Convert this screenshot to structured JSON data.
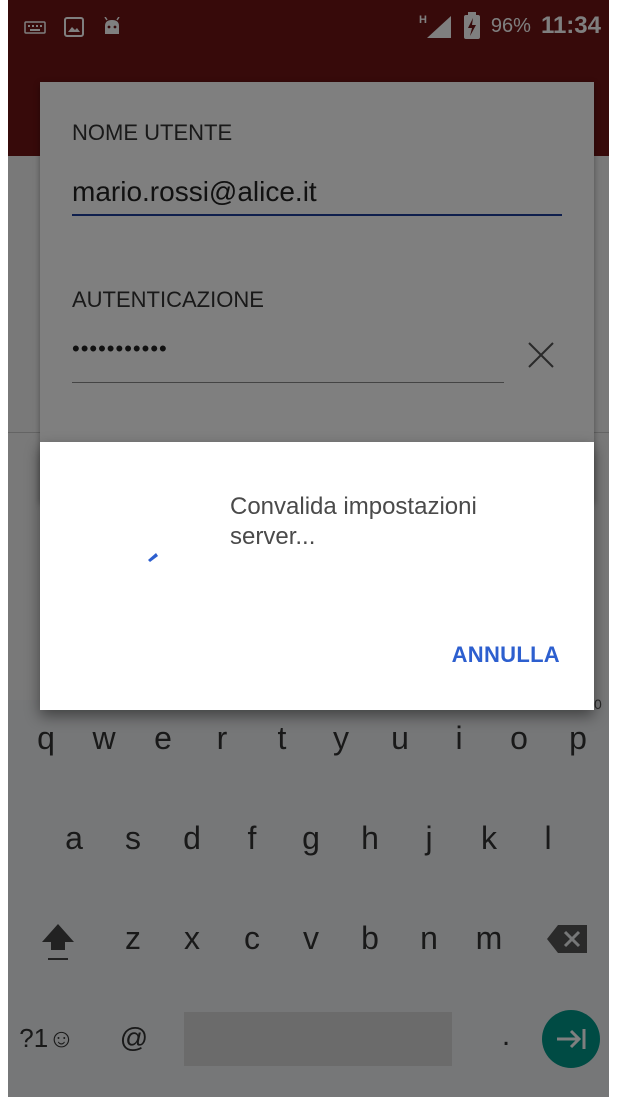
{
  "status_bar": {
    "left_icons": [
      "keyboard-icon",
      "image-icon",
      "android-icon"
    ],
    "network": "H",
    "battery_percent": "96%",
    "time": "11:34"
  },
  "form": {
    "username_label": "NOME UTENTE",
    "username_value": "mario.rossi@alice.it",
    "auth_label": "AUTENTICAZIONE",
    "auth_value": "•••••••••••"
  },
  "dialog": {
    "message": "Convalida impostazioni server...",
    "cancel_label": "ANNULLA"
  },
  "keyboard": {
    "row1": [
      "q",
      "w",
      "e",
      "r",
      "t",
      "y",
      "u",
      "i",
      "o",
      "p"
    ],
    "row1_hint": "0",
    "row2": [
      "a",
      "s",
      "d",
      "f",
      "g",
      "h",
      "j",
      "k",
      "l"
    ],
    "row3": [
      "z",
      "x",
      "c",
      "v",
      "b",
      "n",
      "m"
    ],
    "symbols_label": "?1☺",
    "at_label": "@",
    "period_label": "."
  },
  "colors": {
    "app_bar": "#6e1414",
    "accent": "#2d5fcf",
    "enter_key": "#009688"
  }
}
